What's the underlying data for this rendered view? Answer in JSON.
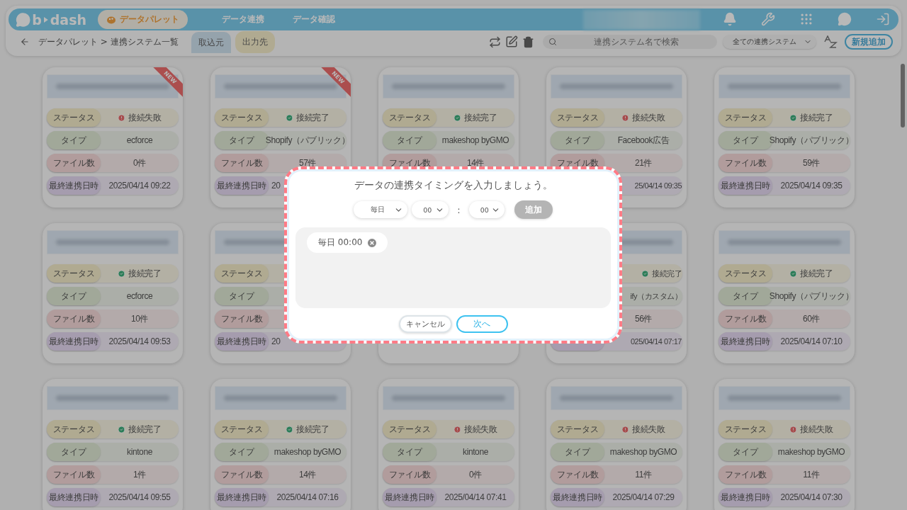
{
  "header": {
    "logo_left": "b",
    "logo_right": "dash",
    "nav": [
      {
        "label": "データパレット",
        "selected": true
      },
      {
        "label": "データ連携",
        "selected": false
      },
      {
        "label": "データ確認",
        "selected": false
      }
    ]
  },
  "toolbar": {
    "breadcrumb": "データパレット > 連携システム一覧",
    "tabs": [
      {
        "label": "取込元",
        "selected": true
      },
      {
        "label": "出力先",
        "selected": false
      }
    ],
    "search": {
      "placeholder": "連携システム名で検索"
    },
    "filter": "全ての連携システム",
    "add_button": "新規追加"
  },
  "cards": [
    {
      "badge": "NEW",
      "rows": [
        {
          "kind": "status",
          "label": "ステータス",
          "value": "接続失敗",
          "connected": false
        },
        {
          "kind": "type",
          "label": "タイプ",
          "value": "ecforce"
        },
        {
          "kind": "files",
          "label": "ファイル数",
          "value": "0件"
        },
        {
          "kind": "date",
          "label": "最終連携日時",
          "value": "2025/04/14 09:22"
        }
      ]
    },
    {
      "badge": "NEW",
      "rows": [
        {
          "kind": "status",
          "label": "ステータス",
          "value": "接続完了",
          "connected": true
        },
        {
          "kind": "type",
          "label": "タイプ",
          "value": "Shopify（パブリック）"
        },
        {
          "kind": "files",
          "label": "ファイル数",
          "value": "57件"
        },
        {
          "kind": "date",
          "label": "最終連携日時",
          "value": "20",
          "cut_end": true
        }
      ]
    },
    {
      "rows": [
        {
          "kind": "status",
          "label": "ステータス",
          "value": "接続完了",
          "connected": true
        },
        {
          "kind": "type",
          "label": "タイプ",
          "value": "makeshop byGMO"
        },
        {
          "kind": "files",
          "label": "ファイル数",
          "value": "14件"
        }
      ]
    },
    {
      "rows": [
        {
          "kind": "status",
          "label": "ステータス",
          "value": "接続失敗",
          "connected": false
        },
        {
          "kind": "type",
          "label": "タイプ",
          "value": "Facebook広告"
        },
        {
          "kind": "files",
          "label": "ファイル数",
          "value": "21件"
        },
        {
          "kind": "date",
          "value": "25/04/14 09:35",
          "cut_start": true
        }
      ]
    },
    {
      "rows": [
        {
          "kind": "status",
          "label": "ステータス",
          "value": "接続完了",
          "connected": true
        },
        {
          "kind": "type",
          "label": "タイプ",
          "value": "Shopify（パブリック）"
        },
        {
          "kind": "files",
          "label": "ファイル数",
          "value": "59件"
        },
        {
          "kind": "date",
          "label": "最終連携日時",
          "value": "2025/04/14 09:35"
        }
      ]
    },
    {
      "rows": [
        {
          "kind": "status",
          "label": "ステータス",
          "value": "接続完了",
          "connected": true
        },
        {
          "kind": "type",
          "label": "タイプ",
          "value": "ecforce"
        },
        {
          "kind": "files",
          "label": "ファイル数",
          "value": "10件"
        },
        {
          "kind": "date",
          "label": "最終連携日時",
          "value": "2025/04/14 09:53"
        }
      ]
    },
    {
      "rows": [
        {
          "kind": "status",
          "label": "ステータス"
        },
        {
          "kind": "type",
          "label": "タイプ"
        },
        {
          "kind": "files",
          "label": "ファイル数"
        },
        {
          "kind": "date",
          "label": "最終連携日時",
          "value": "20",
          "cut_end": true
        }
      ]
    },
    {
      "covered": true
    },
    {
      "rows": [
        {
          "kind": "status",
          "value": "接続完了",
          "connected": true,
          "cut_start": true
        },
        {
          "kind": "type",
          "value": "ify（カスタム）",
          "cut_start": true
        },
        {
          "kind": "files",
          "value": "56件"
        },
        {
          "kind": "date",
          "value": "025/04/14 07:17",
          "cut_start": true
        }
      ]
    },
    {
      "rows": [
        {
          "kind": "status",
          "label": "ステータス",
          "value": "接続完了",
          "connected": true
        },
        {
          "kind": "type",
          "label": "タイプ",
          "value": "Shopify（パブリック）"
        },
        {
          "kind": "files",
          "label": "ファイル数",
          "value": "60件"
        },
        {
          "kind": "date",
          "label": "最終連携日時",
          "value": "2025/04/14 07:10"
        }
      ]
    },
    {
      "rows": [
        {
          "kind": "status",
          "label": "ステータス",
          "value": "接続完了",
          "connected": true
        },
        {
          "kind": "type",
          "label": "タイプ",
          "value": "kintone"
        },
        {
          "kind": "files",
          "label": "ファイル数",
          "value": "1件"
        },
        {
          "kind": "date",
          "label": "最終連携日時",
          "value": "2025/04/14 09:55"
        }
      ]
    },
    {
      "rows": [
        {
          "kind": "status",
          "label": "ステータス",
          "value": "接続完了",
          "connected": true
        },
        {
          "kind": "type",
          "label": "タイプ",
          "value": "makeshop byGMO"
        },
        {
          "kind": "files",
          "label": "ファイル数",
          "value": "14件"
        },
        {
          "kind": "date",
          "label": "最終連携日時",
          "value": "2025/04/14 07:16"
        }
      ]
    },
    {
      "rows": [
        {
          "kind": "status",
          "label": "ステータス",
          "value": "接続失敗",
          "connected": false
        },
        {
          "kind": "type",
          "label": "タイプ",
          "value": "kintone"
        },
        {
          "kind": "files",
          "label": "ファイル数",
          "value": "0件"
        },
        {
          "kind": "date",
          "label": "最終連携日時",
          "value": "2025/04/14 07:41"
        }
      ]
    },
    {
      "rows": [
        {
          "kind": "status",
          "label": "ステータス",
          "value": "接続失敗",
          "connected": false
        },
        {
          "kind": "type",
          "label": "タイプ",
          "value": "makeshop byGMO"
        },
        {
          "kind": "files",
          "label": "ファイル数",
          "value": "11件"
        },
        {
          "kind": "date",
          "label": "最終連携日時",
          "value": "2025/04/14 07:29"
        }
      ]
    },
    {
      "rows": [
        {
          "kind": "status",
          "label": "ステータス",
          "value": "接続失敗",
          "connected": false
        },
        {
          "kind": "type",
          "label": "タイプ",
          "value": "makeshop byGMO"
        },
        {
          "kind": "files",
          "label": "ファイル数",
          "value": "11件"
        },
        {
          "kind": "date",
          "label": "最終連携日時",
          "value": "2025/04/14 07:30"
        }
      ]
    }
  ],
  "modal": {
    "title": "データの連携タイミングを入力しましょう。",
    "day": "毎日",
    "hour": "00",
    "separator": ":",
    "minute": "00",
    "add_button": {
      "label": "追加",
      "disabled": true
    },
    "entries": [
      {
        "label": "毎日 00:00"
      }
    ],
    "cancel": "キャンセル",
    "next": "次へ"
  }
}
